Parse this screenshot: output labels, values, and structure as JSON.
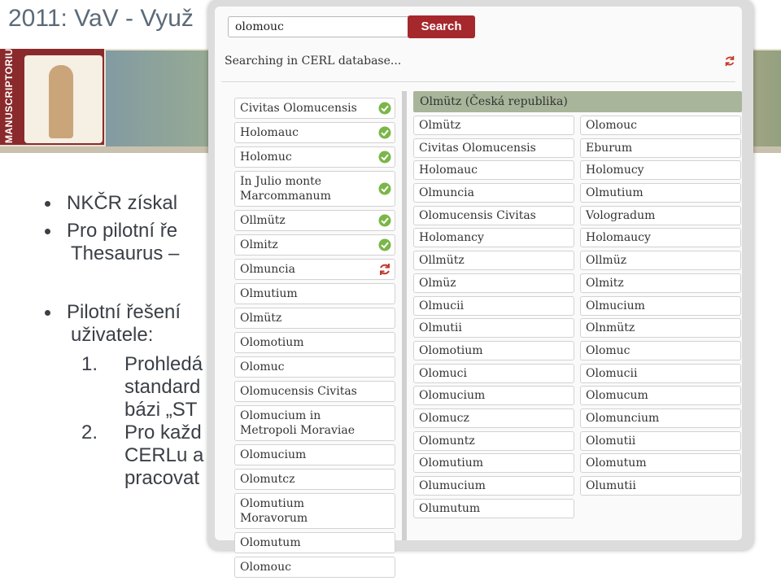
{
  "slide": {
    "title": "2011: VaV - Využ",
    "logo_text": "MANUSCRIPTORIUM",
    "bullets": [
      "NKČR získal",
      "Pro pilotní ře",
      "Thesaurus –",
      "Pilotní řešení",
      "uživatele:",
      "1.",
      "Prohledá",
      "standard",
      "bázi „ST",
      "2.",
      "Pro každ",
      "CERLu a",
      "pracovat"
    ]
  },
  "search": {
    "value": "olomouc",
    "button_label": "Search",
    "status": "Searching in CERL database..."
  },
  "colors": {
    "accent": "#a5282c",
    "ok": "#7ab648",
    "header": "#a8b59a"
  },
  "left_list": [
    {
      "label": "Civitas Olomucensis",
      "icon": "check-icon"
    },
    {
      "label": "Holomauc",
      "icon": "check-icon"
    },
    {
      "label": "Holomuc",
      "icon": "check-icon"
    },
    {
      "label": "In Julio monte Marcommanum",
      "icon": "check-icon"
    },
    {
      "label": "Ollmütz",
      "icon": "check-icon"
    },
    {
      "label": "Olmitz",
      "icon": "check-icon"
    },
    {
      "label": "Olmuncia",
      "icon": "refresh-icon"
    },
    {
      "label": "Olmutium",
      "icon": ""
    },
    {
      "label": "Olmütz",
      "icon": ""
    },
    {
      "label": "Olomotium",
      "icon": ""
    },
    {
      "label": "Olomuc",
      "icon": ""
    },
    {
      "label": "Olomucensis Civitas",
      "icon": ""
    },
    {
      "label": "Olomucium in Metropoli Moraviae",
      "icon": ""
    },
    {
      "label": "Olomucium",
      "icon": ""
    },
    {
      "label": "Olomutcz",
      "icon": ""
    },
    {
      "label": "Olomutium Moravorum",
      "icon": ""
    },
    {
      "label": "Olomutum",
      "icon": ""
    },
    {
      "label": "Olomouc",
      "icon": ""
    }
  ],
  "group": {
    "header": "Olmütz (Česká republika)",
    "col1": [
      "Olmütz",
      "Civitas Olomucensis",
      "Holomauc",
      "Olmuncia",
      "Olomucensis Civitas",
      "Holomancy",
      "Ollmütz",
      "Olmüz",
      "Olmucii",
      "Olmutii",
      "Olomotium",
      "Olomuci",
      "Olomucium",
      "Olomucz",
      "Olomuntz",
      "Olomutium",
      "Olumucium",
      "Olumutum"
    ],
    "col2": [
      "Olomouc",
      "Eburum",
      "Holomucy",
      "Olmutium",
      "Vologradum",
      "Holomaucy",
      "Ollmüz",
      "Olmitz",
      "Olmucium",
      "Olnmütz",
      "Olomuc",
      "Olomucii",
      "Olomucum",
      "Olomuncium",
      "Olomutii",
      "Olomutum",
      "Olumutii"
    ]
  }
}
